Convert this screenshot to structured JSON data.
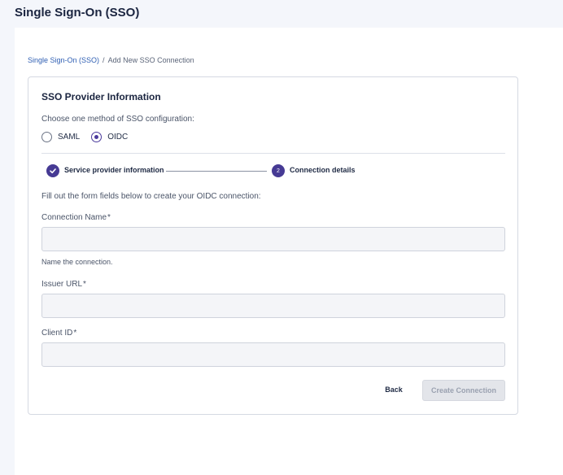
{
  "header": {
    "title": "Single Sign-On (SSO)"
  },
  "breadcrumb": {
    "parent": "Single Sign-On (SSO)",
    "separator": "/",
    "current": "Add New SSO Connection"
  },
  "card": {
    "title": "SSO Provider Information",
    "method_label": "Choose one method of SSO configuration:",
    "methods": [
      {
        "label": "SAML",
        "selected": false
      },
      {
        "label": "OIDC",
        "selected": true
      }
    ],
    "steps": [
      {
        "label": "Service provider information",
        "status": "complete",
        "icon": "checkmark-icon"
      },
      {
        "label": "Connection details",
        "status": "current",
        "number": "2"
      }
    ],
    "instructions": "Fill out the form fields below to create your OIDC connection:",
    "fields": [
      {
        "label": "Connection Name",
        "required_mark": "*",
        "value": "",
        "placeholder": "",
        "help": "Name the connection."
      },
      {
        "label": "Issuer URL",
        "required_mark": "*",
        "value": "",
        "placeholder": ""
      },
      {
        "label": "Client ID",
        "required_mark": "*",
        "value": "",
        "placeholder": ""
      }
    ],
    "actions": {
      "back_label": "Back",
      "create_label": "Create Connection",
      "create_disabled": true
    }
  },
  "colors": {
    "accent": "#463a94",
    "link": "#2f5fb3",
    "page_bg": "#f4f6fb",
    "input_bg": "#f4f5f8",
    "disabled_button_bg": "#e3e5ea"
  }
}
